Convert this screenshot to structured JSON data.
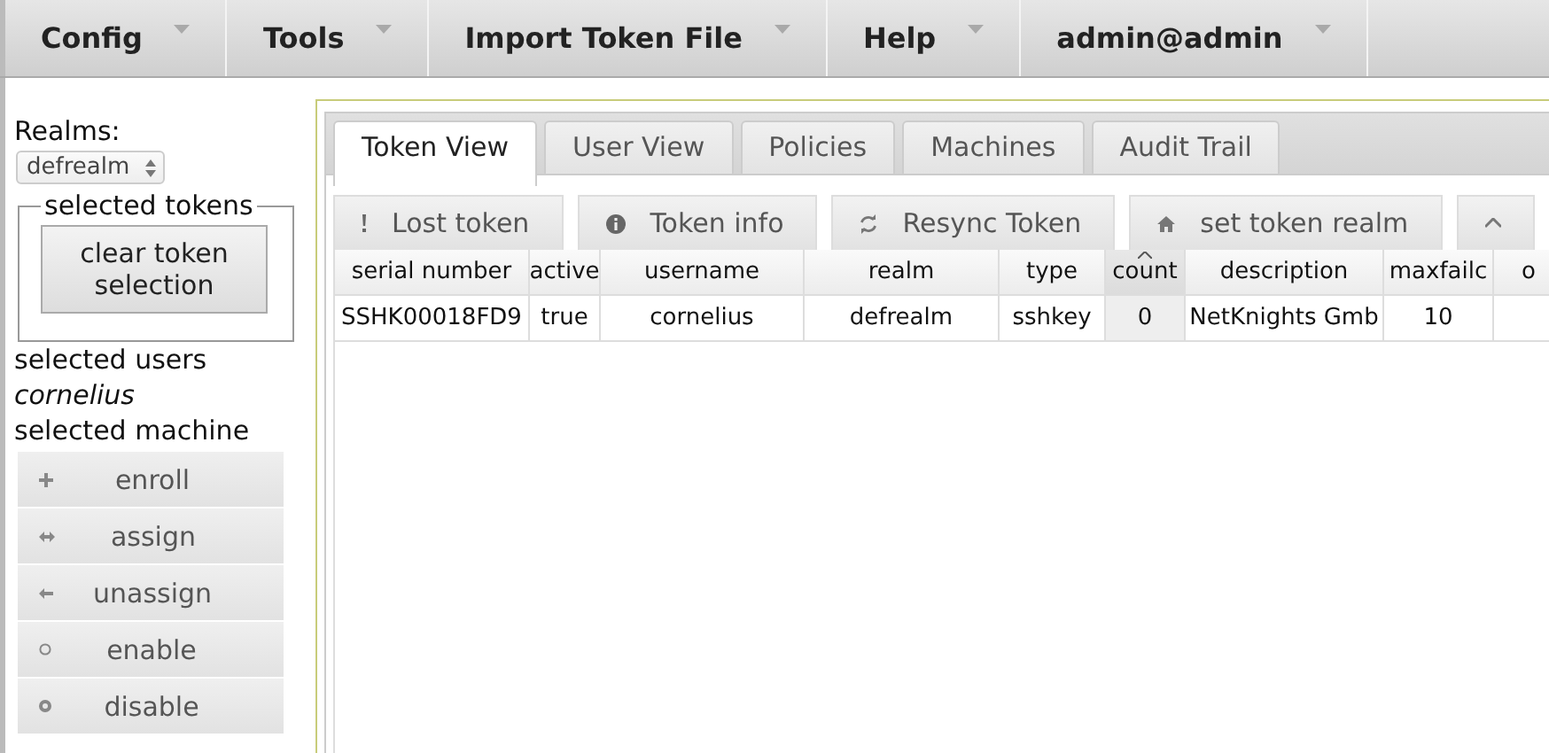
{
  "menu": [
    {
      "label": "Config"
    },
    {
      "label": "Tools"
    },
    {
      "label": "Import Token File"
    },
    {
      "label": "Help"
    },
    {
      "label": "admin@admin"
    }
  ],
  "sidebar": {
    "realms_label": "Realms:",
    "realm_select": {
      "value": "defrealm"
    },
    "token_group": {
      "legend": "selected tokens",
      "button": "clear token selection"
    },
    "selected_users_label": "selected users",
    "selected_user": "cornelius",
    "selected_machine_label": "selected machine",
    "actions": [
      {
        "label": "enroll",
        "kind": "plus"
      },
      {
        "label": "assign",
        "kind": "both"
      },
      {
        "label": "unassign",
        "kind": "left"
      },
      {
        "label": "enable",
        "kind": "ring"
      },
      {
        "label": "disable",
        "kind": "dot"
      }
    ]
  },
  "tabs": [
    {
      "label": "Token View",
      "selected": true
    },
    {
      "label": "User View",
      "selected": false
    },
    {
      "label": "Policies",
      "selected": false
    },
    {
      "label": "Machines",
      "selected": false
    },
    {
      "label": "Audit Trail",
      "selected": false
    }
  ],
  "toolbar": [
    {
      "label": "Lost token",
      "kind": "exclaim"
    },
    {
      "label": "Token info",
      "kind": "info"
    },
    {
      "label": "Resync Token",
      "kind": "sync"
    },
    {
      "label": "set token realm",
      "kind": "home"
    },
    {
      "kind": "caret"
    }
  ],
  "table": {
    "columns": [
      {
        "label": "serial number",
        "sorted": false
      },
      {
        "label": "active",
        "sorted": false
      },
      {
        "label": "username",
        "sorted": false
      },
      {
        "label": "realm",
        "sorted": false
      },
      {
        "label": "type",
        "sorted": false
      },
      {
        "label": "count",
        "sorted": true
      },
      {
        "label": "description",
        "sorted": false
      },
      {
        "label": "maxfailc",
        "sorted": false
      },
      {
        "label": "o",
        "sorted": false
      }
    ],
    "rows": [
      [
        "SSHK00018FD9",
        "true",
        "cornelius",
        "defrealm",
        "sshkey",
        "0",
        "NetKnights Gmb",
        "10",
        ""
      ]
    ]
  }
}
